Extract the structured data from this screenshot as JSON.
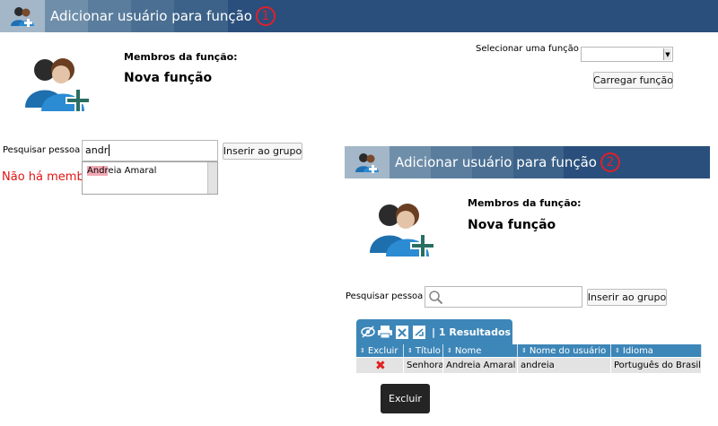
{
  "panel1": {
    "header_title": "Adicionar usuário para função",
    "badge": "1",
    "members_label": "Membros da função:",
    "role_name": "Nova função",
    "select_role_label": "Selecionar uma função",
    "select_role_value": "",
    "load_role_button": "Carregar função",
    "search_label": "Pesquisar pessoa",
    "search_value": "andr",
    "insert_button": "Inserir ao grupo",
    "suggestion": {
      "highlight": "Andr",
      "rest": "eia Amaral"
    },
    "no_members_message": "Não há membros"
  },
  "panel2": {
    "header_title": "Adicionar usuário para função",
    "badge": "2",
    "members_label": "Membros da função:",
    "role_name": "Nova função",
    "search_label": "Pesquisar pessoa",
    "search_value": "",
    "insert_button": "Inserir ao grupo",
    "results_label": "| 1 Resultados",
    "columns": [
      "Excluir",
      "Título",
      "Nome",
      "Nome do usuário",
      "Idioma"
    ],
    "rows": [
      {
        "titulo": "Senhora",
        "nome": "Andreia Amaral",
        "usuario": "andreia",
        "idioma": "Português do Brasil"
      }
    ],
    "delete_button": "Excluir"
  },
  "colors": {
    "header": "#2a4f7c",
    "grid": "#3d86b8",
    "error": "#e01414",
    "badge": "#e0202a"
  },
  "icons": [
    "users-group-icon",
    "add-user-icon",
    "search-icon",
    "view-icon",
    "print-icon",
    "export-excel-icon",
    "export-xml-icon",
    "delete-x-icon",
    "dropdown-arrow-icon"
  ]
}
